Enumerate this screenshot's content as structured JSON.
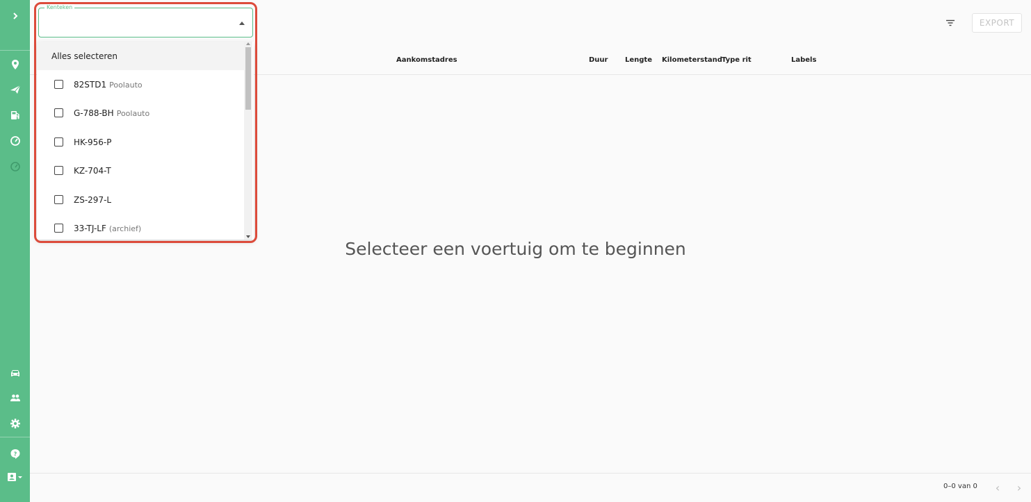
{
  "sidebar": {
    "expand_icon": "chevron-right-icon",
    "items": [
      {
        "name": "location-icon"
      },
      {
        "name": "send-icon"
      },
      {
        "name": "fuel-icon"
      },
      {
        "name": "speedometer-icon"
      },
      {
        "name": "speedometer-outline-icon"
      }
    ],
    "bottom_items": [
      {
        "name": "car-icon"
      },
      {
        "name": "people-icon"
      },
      {
        "name": "gear-icon"
      },
      {
        "name": "help-icon"
      },
      {
        "name": "account-icon"
      }
    ],
    "color": "#5bbd89"
  },
  "toolbar": {
    "filter_icon": "filter-icon",
    "export_label": "EXPORT"
  },
  "table": {
    "columns": [
      "Aankomstadres",
      "Duur",
      "Lengte",
      "Kilometerstand",
      "Type rit",
      "Labels"
    ],
    "empty_message": "Selecteer een voertuig om te beginnen"
  },
  "select": {
    "label": "Kenteken",
    "value": "",
    "select_all_label": "Alles selecteren",
    "options": [
      {
        "plate": "82STD1",
        "note": "Poolauto"
      },
      {
        "plate": "G-788-BH",
        "note": "Poolauto"
      },
      {
        "plate": "HK-956-P",
        "note": ""
      },
      {
        "plate": "KZ-704-T",
        "note": ""
      },
      {
        "plate": "ZS-297-L",
        "note": ""
      },
      {
        "plate": "33-TJ-LF",
        "note": "(archief)"
      }
    ]
  },
  "pagination": {
    "count_text": "0–0 van 0",
    "prev": "‹",
    "next": "›"
  },
  "colors": {
    "accent": "#5bbd89",
    "highlight": "#dc4b3b"
  }
}
